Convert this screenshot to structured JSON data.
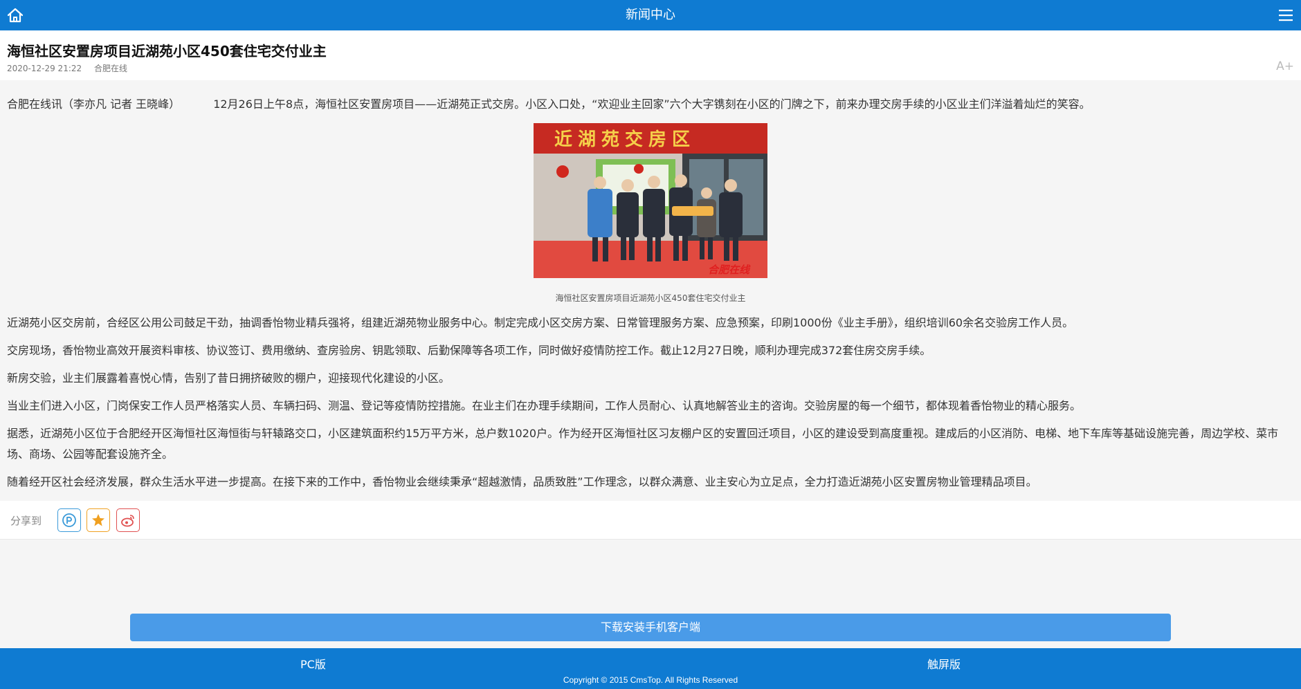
{
  "topbar": {
    "title": "新闻中心",
    "home_icon": "home-icon",
    "menu_icon": "menu-icon"
  },
  "article": {
    "title": "海恒社区安置房项目近湖苑小区450套住宅交付业主",
    "date": "2020-12-29 21:22",
    "source": "合肥在线",
    "font_size_control": "A+",
    "lead_byline": "合肥在线讯（李亦凡 记者 王晓峰）",
    "lead_text": "12月26日上午8点，海恒社区安置房项目——近湖苑正式交房。小区入口处，“欢迎业主回家”六个大字镌刻在小区的门牌之下，前来办理交房手续的小区业主们洋溢着灿烂的笑容。",
    "photo": {
      "banner_text": "近湖苑交房区",
      "watermark": "合肥在线",
      "caption": "海恒社区安置房项目近湖苑小区450套住宅交付业主"
    },
    "paragraphs": [
      "近湖苑小区交房前，合经区公用公司鼓足干劲，抽调香怡物业精兵强将，组建近湖苑物业服务中心。制定完成小区交房方案、日常管理服务方案、应急预案，印刷1000份《业主手册》，组织培训60余名交验房工作人员。",
      "交房现场，香怡物业高效开展资料审核、协议签订、费用缴纳、查房验房、钥匙领取、后勤保障等各项工作，同时做好疫情防控工作。截止12月27日晚，顺利办理完成372套住房交房手续。",
      "新房交验，业主们展露着喜悦心情，告别了昔日拥挤破败的棚户，迎接现代化建设的小区。",
      "当业主们进入小区，门岗保安工作人员严格落实人员、车辆扫码、测温、登记等疫情防控措施。在业主们在办理手续期间，工作人员耐心、认真地解答业主的咨询。交验房屋的每一个细节，都体现着香怡物业的精心服务。",
      "据悉，近湖苑小区位于合肥经开区海恒社区海恒街与轩辕路交口，小区建筑面积约15万平方米，总户数1020户。作为经开区海恒社区习友棚户区的安置回迁项目，小区的建设受到高度重视。建成后的小区消防、电梯、地下车库等基础设施完善，周边学校、菜市场、商场、公园等配套设施齐全。",
      "随着经开区社会经济发展，群众生活水平进一步提高。在接下来的工作中，香怡物业会继续秉承“超越激情，品质致胜”工作理念，以群众满意、业主安心为立足点，全力打造近湖苑小区安置房物业管理精品项目。"
    ]
  },
  "share": {
    "label": "分享到",
    "targets": [
      "qzone-icon",
      "favorite-star-icon",
      "weibo-icon"
    ],
    "colors": [
      "#3a9ad9",
      "#f0a020",
      "#e05050"
    ]
  },
  "download": {
    "label": "下载安装手机客户端"
  },
  "footer": {
    "pc_label": "PC版",
    "touch_label": "触屏版",
    "copyright": "Copyright © 2015 CmsTop. All Rights Reserved"
  },
  "colors": {
    "brand_blue": "#0f7bd2",
    "button_blue": "#4a9be8"
  }
}
